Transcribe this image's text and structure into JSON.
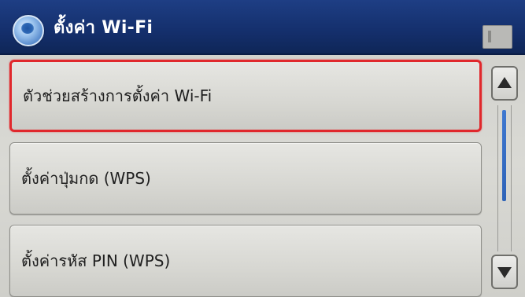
{
  "header": {
    "title": "ตั้งค่า Wi-Fi",
    "icon": "globe-icon"
  },
  "menu": {
    "items": [
      {
        "label": "ตัวช่วยสร้างการตั้งค่า Wi-Fi",
        "selected": true
      },
      {
        "label": "ตั้งค่าปุ่มกด (WPS)",
        "selected": false
      },
      {
        "label": "ตั้งค่ารหัส PIN (WPS)",
        "selected": false
      }
    ]
  },
  "scrollbar": {
    "up_icon": "arrow-up-icon",
    "down_icon": "arrow-down-icon"
  },
  "colors": {
    "header_bg": "#142f6c",
    "selection_border": "#e0282c",
    "scroll_thumb": "#2e63b8"
  }
}
